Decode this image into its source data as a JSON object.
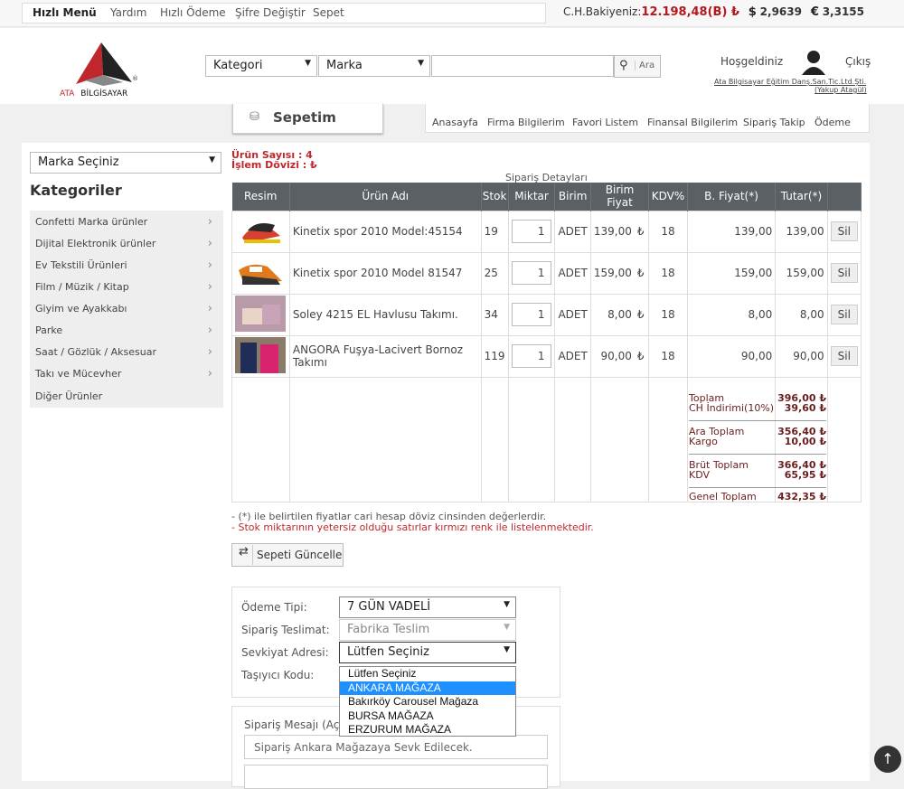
{
  "topnav": {
    "items": [
      "Hızlı Menü",
      "Yardım",
      "Hızlı Ödeme",
      "Şifre Değiştir",
      "Sepet"
    ]
  },
  "balance": {
    "label": "C.H.Bakiyeniz:",
    "amount": "12.198,48(B) ₺",
    "usd_symbol": "$",
    "usd": "2,9639",
    "eur_symbol": "€",
    "eur": "3,3155"
  },
  "logo": {
    "text_ata": "ATA",
    "text_bil": "BİLGİSAYAR",
    "mark": "®"
  },
  "search": {
    "category": "Kategori",
    "brand": "Marka",
    "query": "",
    "button": "Ara"
  },
  "user": {
    "greeting": "Hoşgeldiniz",
    "logout": "Çıkış",
    "company": "Ata Bilgisayar Eğitim Danş.San.Tic.Ltd.Şti.",
    "name": "(Yakup Atagül)"
  },
  "sepetim": "Sepetim",
  "tabs": [
    "Anasayfa",
    "Firma Bilgilerim",
    "Favori Listem",
    "Finansal Bilgilerim",
    "Sipariş Takip",
    "Ödeme"
  ],
  "sidebar": {
    "brand_select": "Marka Seçiniz",
    "title": "Kategoriler",
    "items": [
      "Confetti Marka ürünler",
      "Dijital Elektronik ürünler",
      "Ev Tekstili Ürünleri",
      "Film / Müzik / Kitap",
      "Giyim ve Ayakkabı",
      "Parke",
      "Saat / Gözlük / Aksesuar",
      "Takı ve Mücevher",
      "Diğer Ürünler"
    ]
  },
  "cart": {
    "count_label": "Ürün Sayısı  : 4",
    "currency_label": "İşlem Dövizi : ₺",
    "title": "Sipariş Detayları",
    "headers": [
      "Resim",
      "Ürün Adı",
      "Stok",
      "Miktar",
      "Birim",
      "Birim Fiyat",
      "KDV%",
      "B. Fiyat(*)",
      "Tutar(*)"
    ],
    "rows": [
      {
        "name": "Kinetix spor 2010 Model:45154",
        "stock": "19",
        "qty": "1",
        "unit": "ADET",
        "price": "139,00",
        "cur": "₺",
        "kdv": "18",
        "bprice": "139,00",
        "total": "139,00",
        "del": "Sil"
      },
      {
        "name": "Kinetix spor 2010 Model 81547",
        "stock": "25",
        "qty": "1",
        "unit": "ADET",
        "price": "159,00",
        "cur": "₺",
        "kdv": "18",
        "bprice": "159,00",
        "total": "159,00",
        "del": "Sil"
      },
      {
        "name": "Soley 4215 EL Havlusu Takımı.",
        "stock": "34",
        "qty": "1",
        "unit": "ADET",
        "price": "8,00",
        "cur": "₺",
        "kdv": "18",
        "bprice": "8,00",
        "total": "8,00",
        "del": "Sil"
      },
      {
        "name": "ANGORA Fuşya-Lacivert Bornoz Takımı",
        "stock": "119",
        "qty": "1",
        "unit": "ADET",
        "price": "90,00",
        "cur": "₺",
        "kdv": "18",
        "bprice": "90,00",
        "total": "90,00",
        "del": "Sil"
      }
    ],
    "totals": [
      {
        "l1": "Toplam",
        "v1": "396,00 ₺",
        "l2": "CH İndirimi(10%)",
        "v2": "39,60 ₺"
      },
      {
        "l1": "Ara Toplam",
        "v1": "356,40 ₺",
        "l2": "Kargo",
        "v2": "10,00 ₺"
      },
      {
        "l1": "Brüt Toplam",
        "v1": "366,40 ₺",
        "l2": "KDV",
        "v2": "65,95 ₺"
      },
      {
        "l1": "Genel Toplam",
        "v1": "432,35 ₺"
      }
    ],
    "note1": "- (*) ile belirtilen fiyatlar cari hesap döviz cinsinden değerlerdir.",
    "note2": "- Stok miktarının yetersiz olduğu satırlar kırmızı renk ile listelenmektedir.",
    "update_button": "Sepeti Güncelle"
  },
  "order": {
    "payment_label": "Ödeme Tipi:",
    "payment_value": "7 GÜN VADELİ",
    "delivery_label": "Sipariş Teslimat:",
    "delivery_value": "Fabrika Teslim",
    "address_label": "Sevkiyat Adresi:",
    "address_value": "Lütfen Seçiniz",
    "carrier_label": "Taşıyıcı Kodu:",
    "options": [
      "Lütfen Seçiniz",
      "ANKARA MAĞAZA",
      "Bakırköy Carousel Mağaza",
      "BURSA MAĞAZA",
      "ERZURUM MAĞAZA"
    ],
    "highlighted": "ANKARA MAĞAZA",
    "message_label": "Sipariş Mesajı (Açık",
    "message_value": "Sipariş Ankara Mağazaya Sevk Edilecek."
  },
  "colors": {
    "accent_red": "#b4181e",
    "table_header": "#5a6063",
    "highlight": "#1e90ff"
  }
}
